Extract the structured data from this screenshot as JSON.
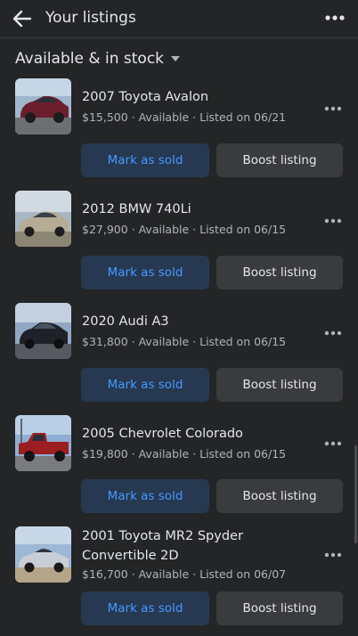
{
  "header": {
    "title": "Your listings"
  },
  "filter": {
    "label": "Available & in stock"
  },
  "colors": {
    "accent": "#4599ff",
    "background": "#242526",
    "primary_button_bg": "#263951",
    "secondary_button_bg": "#3a3b3c"
  },
  "icons": {
    "back": "arrow-left-icon",
    "more": "more-horizontal-icon",
    "caret": "caret-down-icon"
  },
  "listings": [
    {
      "title": "2007 Toyota Avalon",
      "meta": "$15,500 · Available · Listed on 06/21",
      "mark_sold": "Mark as sold",
      "boost": "Boost listing"
    },
    {
      "title": "2012 BMW 740Li",
      "meta": "$27,900 · Available · Listed on 06/15",
      "mark_sold": "Mark as sold",
      "boost": "Boost listing"
    },
    {
      "title": "2020 Audi A3",
      "meta": "$31,800 · Available · Listed on 06/15",
      "mark_sold": "Mark as sold",
      "boost": "Boost listing"
    },
    {
      "title": "2005 Chevrolet Colorado",
      "meta": "$19,800 · Available · Listed on 06/15",
      "mark_sold": "Mark as sold",
      "boost": "Boost listing"
    },
    {
      "title": "2001 Toyota MR2 Spyder Convertible 2D",
      "meta": "$16,700 · Available · Listed on 06/07",
      "mark_sold": "Mark as sold",
      "boost": "Boost listing"
    }
  ]
}
